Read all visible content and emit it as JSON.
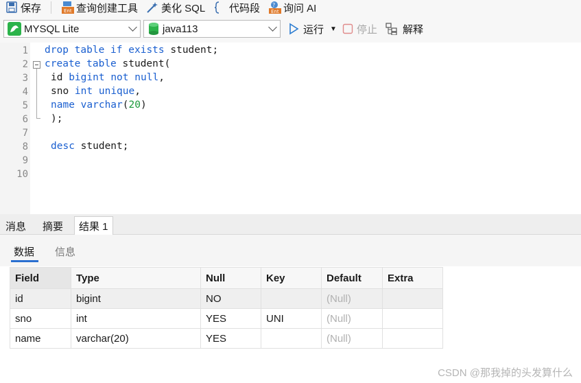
{
  "toolbar": {
    "save": "保存",
    "query_builder": "查询创建工具",
    "beautify": "美化 SQL",
    "snippet": "代码段",
    "ask_ai": "询问 AI"
  },
  "connection": {
    "selected": "MYSQL Lite"
  },
  "database": {
    "selected": "java113"
  },
  "actions": {
    "run": "运行",
    "stop": "停止",
    "explain": "解释"
  },
  "editor": {
    "line_numbers": [
      "1",
      "2",
      "3",
      "4",
      "5",
      "6",
      "7",
      "8",
      "9",
      "10"
    ]
  },
  "result_tabs": [
    "消息",
    "摘要",
    "结果 1"
  ],
  "sub_tabs": {
    "data": "数据",
    "info": "信息"
  },
  "table": {
    "headers": [
      "Field",
      "Type",
      "Null",
      "Key",
      "Default",
      "Extra"
    ],
    "rows": [
      {
        "field": "id",
        "type": "bigint",
        "null": "NO",
        "key": "",
        "default": "(Null)",
        "extra": ""
      },
      {
        "field": "sno",
        "type": "int",
        "null": "YES",
        "key": "UNI",
        "default": "(Null)",
        "extra": ""
      },
      {
        "field": "name",
        "type": "varchar(20)",
        "null": "YES",
        "key": "",
        "default": "(Null)",
        "extra": ""
      }
    ]
  },
  "watermark": "CSDN @那我掉的头发算什么",
  "colors": {
    "keyword": "#1a5fd0",
    "number": "#1a9a3a",
    "accent": "#2a6fd0",
    "null_text": "#b0b0b0"
  },
  "icons": [
    "save-icon",
    "query-builder-icon",
    "beautify-icon",
    "snippet-icon",
    "ai-icon",
    "mysql-icon",
    "database-icon",
    "run-icon",
    "stop-icon",
    "explain-icon"
  ]
}
